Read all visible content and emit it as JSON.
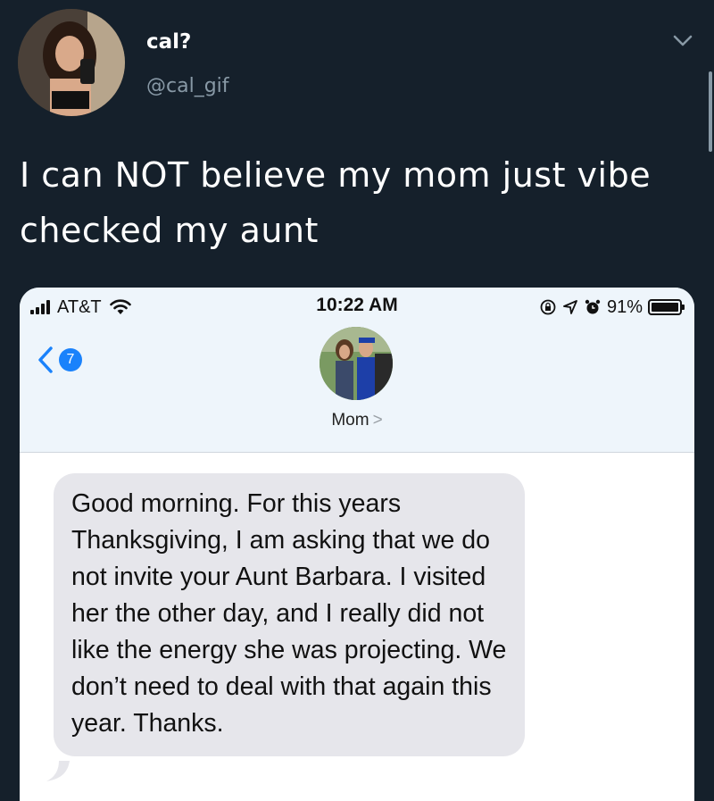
{
  "tweet": {
    "display_name": "cal?",
    "handle": "@cal_gif",
    "text": "I can NOT believe my mom just vibe checked my aunt"
  },
  "screenshot": {
    "status_bar": {
      "carrier": "AT&T",
      "time": "10:22 AM",
      "battery": "91%"
    },
    "back_badge_count": "7",
    "contact_name": "Mom",
    "contact_chevron": ">",
    "message": "Good morning. For this years Thanksgiving, I am asking that we do not invite your Aunt Barbara. I visited her the other day, and I really did not like the energy she was projecting. We don’t need to deal with that again this year. Thanks."
  },
  "colors": {
    "background": "#15202b",
    "ios_blue": "#1a82fb",
    "bubble_gray": "#e6e6eb"
  }
}
